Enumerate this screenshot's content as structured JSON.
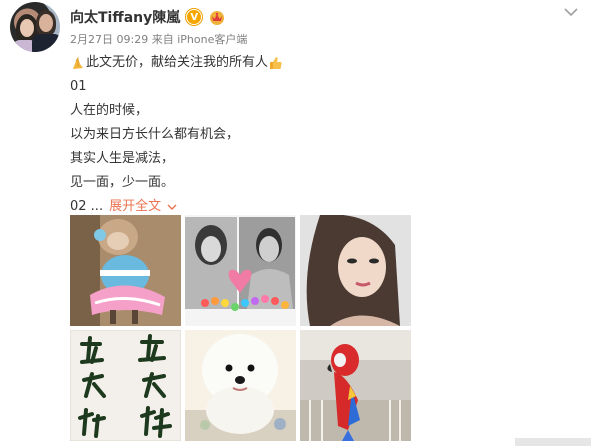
{
  "user": {
    "name": "向太Tiffany陳嵐",
    "verified_badge": "V",
    "verified_color": "#f7a600",
    "vip_icon": "crown-icon"
  },
  "meta": {
    "time": "2月27日 09:29",
    "source_prefix": "来自",
    "source": "iPhone客户端"
  },
  "post": {
    "line1": "此文无价，献给关注我的所有人",
    "line2": "01",
    "line3": "人在的时候，",
    "line4": "以为来日方长什么都有机会，",
    "line5": "其实人生是减法，",
    "line6": "见一面，少一面。",
    "line7_prefix": "02 ...",
    "expand_label": "展开全文",
    "accent_color": "#eb7350"
  },
  "images": [
    {
      "alt": "monkey in tutu"
    },
    {
      "alt": "couple photos with hearts"
    },
    {
      "alt": "woman portrait"
    },
    {
      "alt": "calligraphy"
    },
    {
      "alt": "white puppy"
    },
    {
      "alt": "parrot"
    }
  ]
}
